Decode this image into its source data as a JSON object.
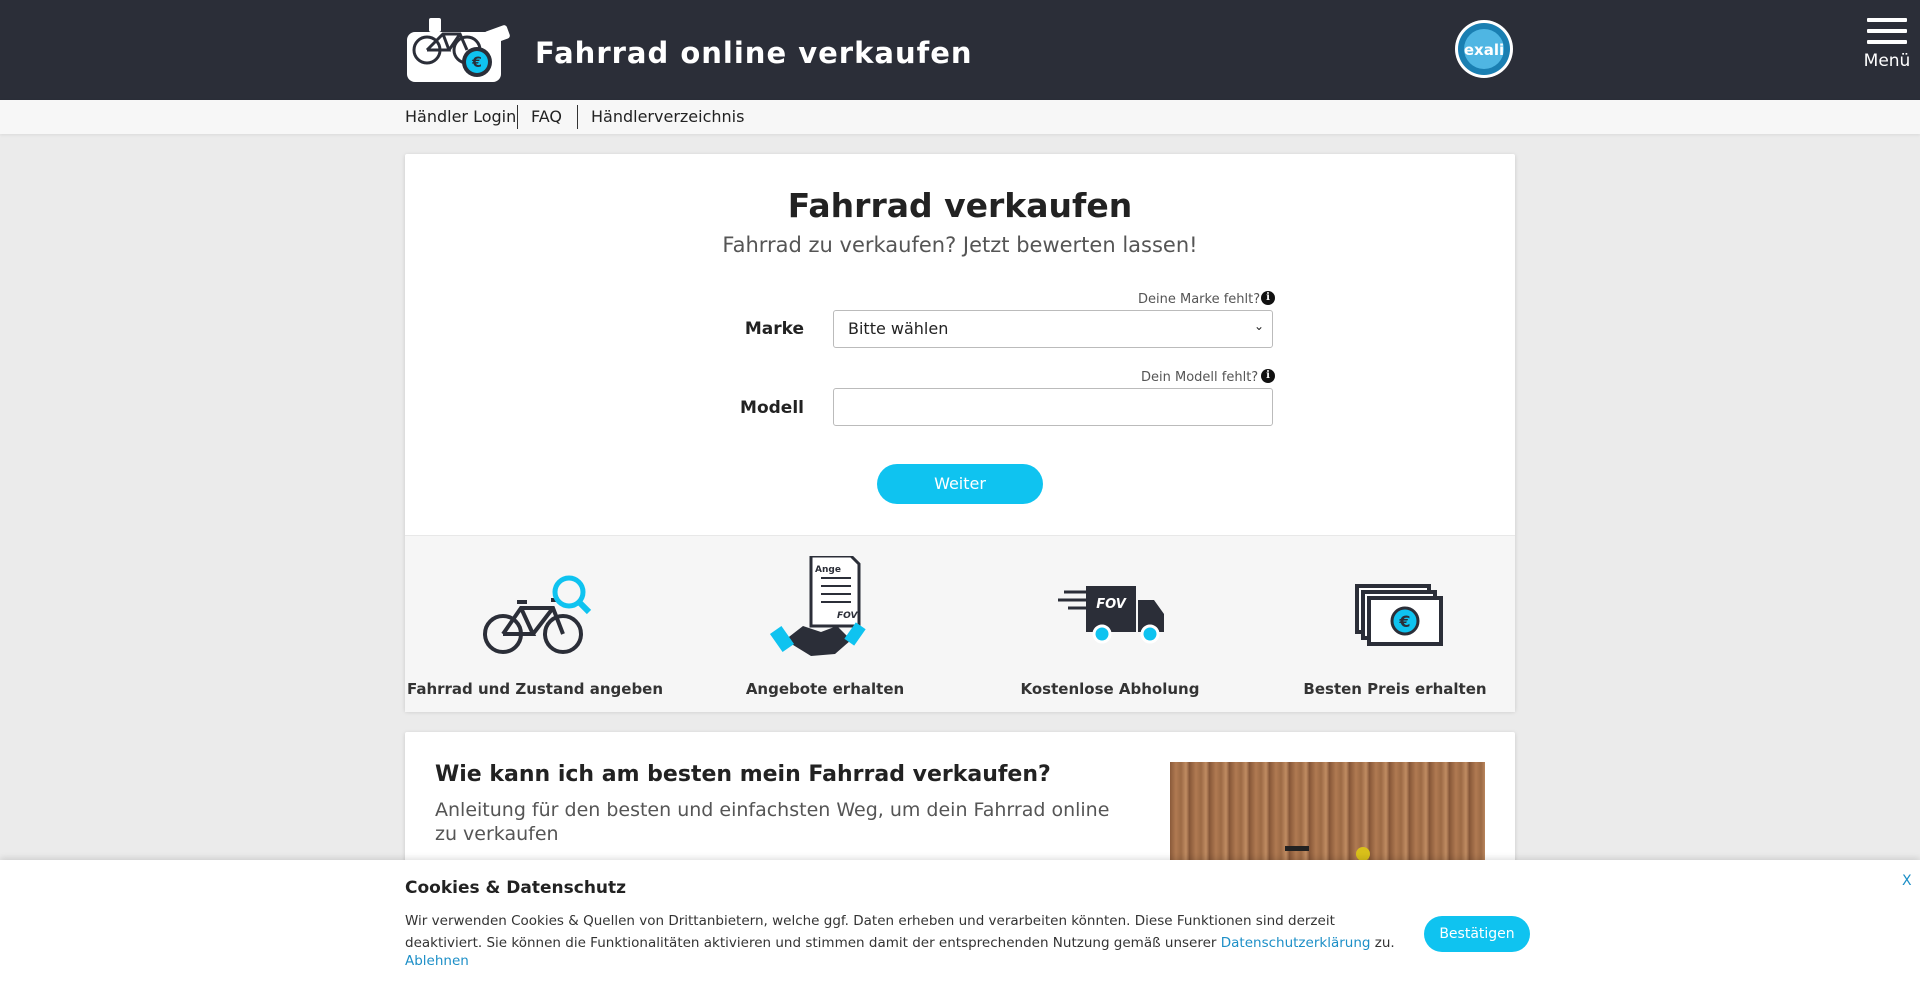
{
  "header": {
    "title": "Fahrrad online verkaufen",
    "menu_label": "Menü",
    "badge_text": "exali"
  },
  "subnav": {
    "items": [
      "Händler Login",
      "FAQ",
      "Händlerverzeichnis"
    ]
  },
  "form": {
    "heading": "Fahrrad verkaufen",
    "subtitle": "Fahrrad zu verkaufen? Jetzt bewerten lassen!",
    "brand_hint": "Deine Marke fehlt?",
    "brand_label": "Marke",
    "brand_selected": "Bitte wählen",
    "model_hint": "Dein Modell fehlt?",
    "model_label": "Modell",
    "model_value": "",
    "next_button": "Weiter"
  },
  "steps": [
    {
      "label": "Fahrrad und Zustand angeben",
      "icon": "bike-search-icon"
    },
    {
      "label": "Angebote erhalten",
      "icon": "offer-handshake-icon",
      "doc_text_top": "Ange",
      "doc_text_bottom": "FOV"
    },
    {
      "label": "Kostenlose Abholung",
      "icon": "truck-icon",
      "truck_text": "FOV"
    },
    {
      "label": "Besten Preis erhalten",
      "icon": "money-icon",
      "currency": "€"
    }
  ],
  "article": {
    "heading": "Wie kann ich am besten mein Fahrrad verkaufen?",
    "lead": "Anleitung für den besten und einfachsten Weg, um dein Fahrrad online zu verkaufen"
  },
  "cookie": {
    "title": "Cookies & Datenschutz",
    "text_before": "Wir verwenden Cookies & Quellen von Drittanbietern, welche ggf. Daten erheben und verarbeiten könnten. Diese Funktionen sind derzeit deaktiviert. Sie können die Funktionalitäten aktivieren und stimmen damit der entsprechenden Nutzung gemäß unserer ",
    "privacy_link": "Datenschutzerklärung",
    "text_after": " zu.",
    "decline": "Ablehnen",
    "confirm": "Bestätigen",
    "close": "X"
  },
  "colors": {
    "header_bg": "#2b2e38",
    "accent": "#0fc3f0",
    "link": "#1d8fc7"
  }
}
